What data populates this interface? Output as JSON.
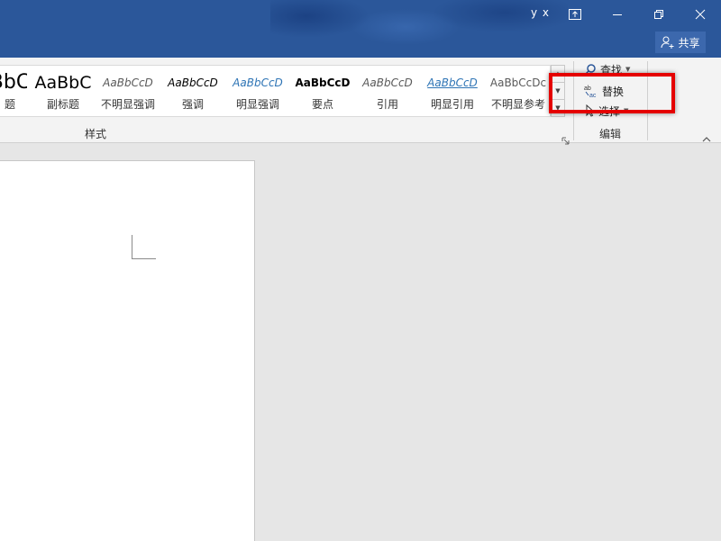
{
  "titlebar": {
    "user": "y x",
    "share_label": "共享",
    "icons": [
      "ribbon-display-options-icon",
      "minimize-icon",
      "restore-icon",
      "close-icon"
    ]
  },
  "styles_gallery": {
    "items": [
      {
        "sample": "BbC",
        "name": "题"
      },
      {
        "sample": "AaBbC",
        "name": "副标题"
      },
      {
        "sample": "AaBbCcD",
        "name": "不明显强调"
      },
      {
        "sample": "AaBbCcD",
        "name": "强调"
      },
      {
        "sample": "AaBbCcD",
        "name": "明显强调"
      },
      {
        "sample": "AaBbCcD",
        "name": "要点"
      },
      {
        "sample": "AaBbCcD",
        "name": "引用"
      },
      {
        "sample": "AaBbCcD",
        "name": "明显引用"
      },
      {
        "sample": "AaBbCcDc",
        "name": "不明显参考"
      }
    ],
    "group_label": "样式"
  },
  "editing": {
    "find_label": "查找",
    "replace_label": "替换",
    "select_label": "选择",
    "group_label": "编辑"
  },
  "colors": {
    "titlebar": "#2b579a",
    "highlight": "#e50000",
    "accent_link": "#2e74b5"
  }
}
